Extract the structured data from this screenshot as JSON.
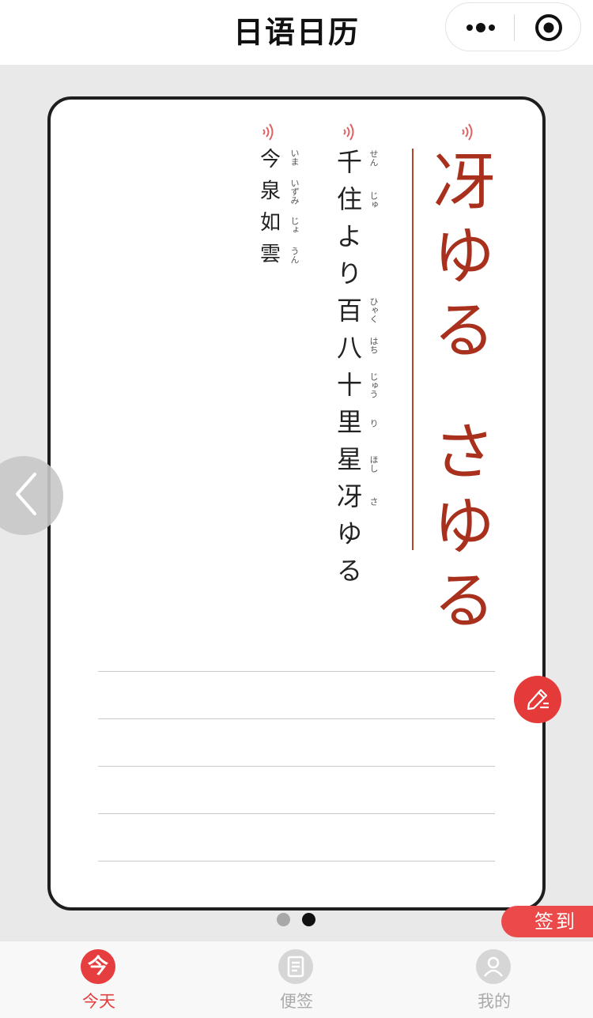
{
  "header": {
    "title": "日语日历"
  },
  "card": {
    "main_word": [
      "冴",
      "ゆ",
      "る",
      "さ",
      "ゆ",
      "る"
    ],
    "poem": [
      {
        "c": "千",
        "r": "せん"
      },
      {
        "c": "住",
        "r": "じゅ"
      },
      {
        "c": "よ",
        "r": ""
      },
      {
        "c": "り",
        "r": ""
      },
      {
        "c": "百",
        "r": "ひゃく"
      },
      {
        "c": "八",
        "r": "はち"
      },
      {
        "c": "十",
        "r": "じゅう"
      },
      {
        "c": "里",
        "r": "り"
      },
      {
        "c": "星",
        "r": "ほし"
      },
      {
        "c": "冴",
        "r": "さ"
      },
      {
        "c": "ゆ",
        "r": ""
      },
      {
        "c": "る",
        "r": ""
      }
    ],
    "author": [
      {
        "c": "今",
        "r": "いま"
      },
      {
        "c": "泉",
        "r": "いずみ"
      },
      {
        "c": "如",
        "r": "じょ"
      },
      {
        "c": "雲",
        "r": "うん"
      }
    ]
  },
  "checkin_label": "签到",
  "tabs": [
    {
      "label": "今天",
      "icon_text": "今"
    },
    {
      "label": "便签"
    },
    {
      "label": "我的"
    }
  ],
  "colors": {
    "accent": "#e63e3e",
    "word": "#a8301d"
  }
}
